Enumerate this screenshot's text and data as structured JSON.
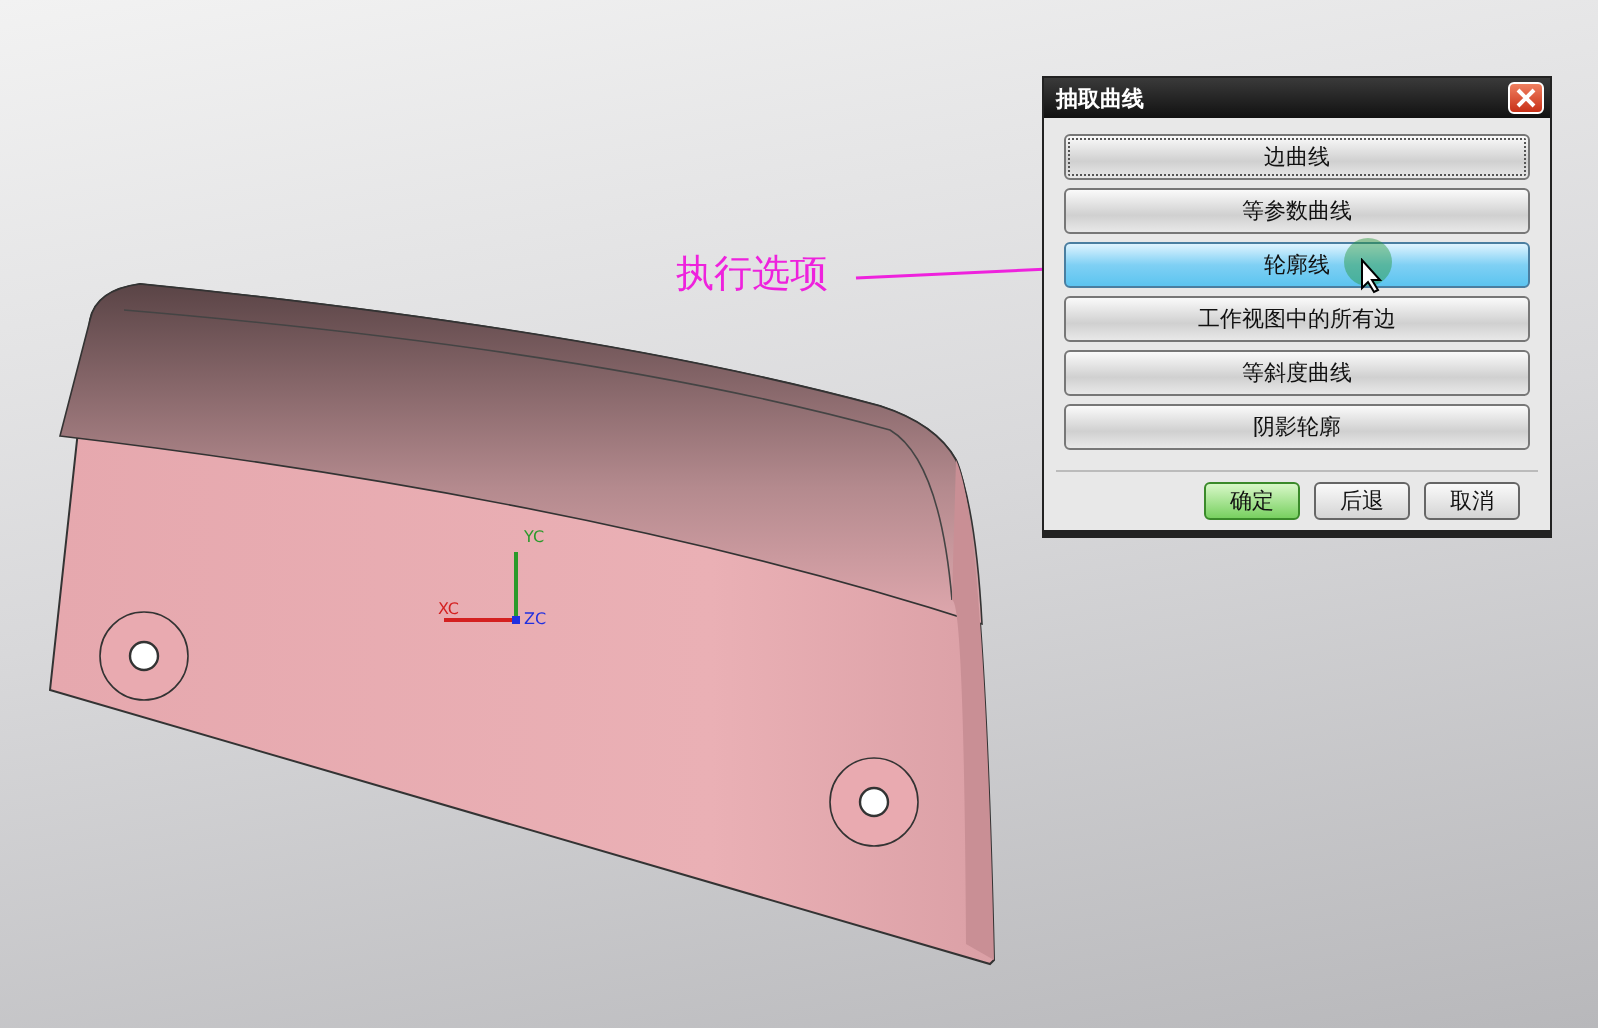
{
  "viewport": {
    "axes": [
      {
        "kind": "x",
        "label": "XC"
      },
      {
        "kind": "y",
        "label": "YC"
      },
      {
        "kind": "z",
        "label": "ZC"
      }
    ]
  },
  "annotation": {
    "text": "执行选项"
  },
  "dialog": {
    "title": "抽取曲线",
    "options": [
      {
        "label": "边曲线",
        "selected": false
      },
      {
        "label": "等参数曲线",
        "selected": false
      },
      {
        "label": "轮廓线",
        "selected": true
      },
      {
        "label": "工作视图中的所有边",
        "selected": false
      },
      {
        "label": "等斜度曲线",
        "selected": false
      },
      {
        "label": "阴影轮廓",
        "selected": false
      }
    ],
    "buttons": [
      {
        "label": "确定",
        "kind": "default"
      },
      {
        "label": "后退",
        "kind": "normal"
      },
      {
        "label": "取消",
        "kind": "normal"
      }
    ]
  }
}
